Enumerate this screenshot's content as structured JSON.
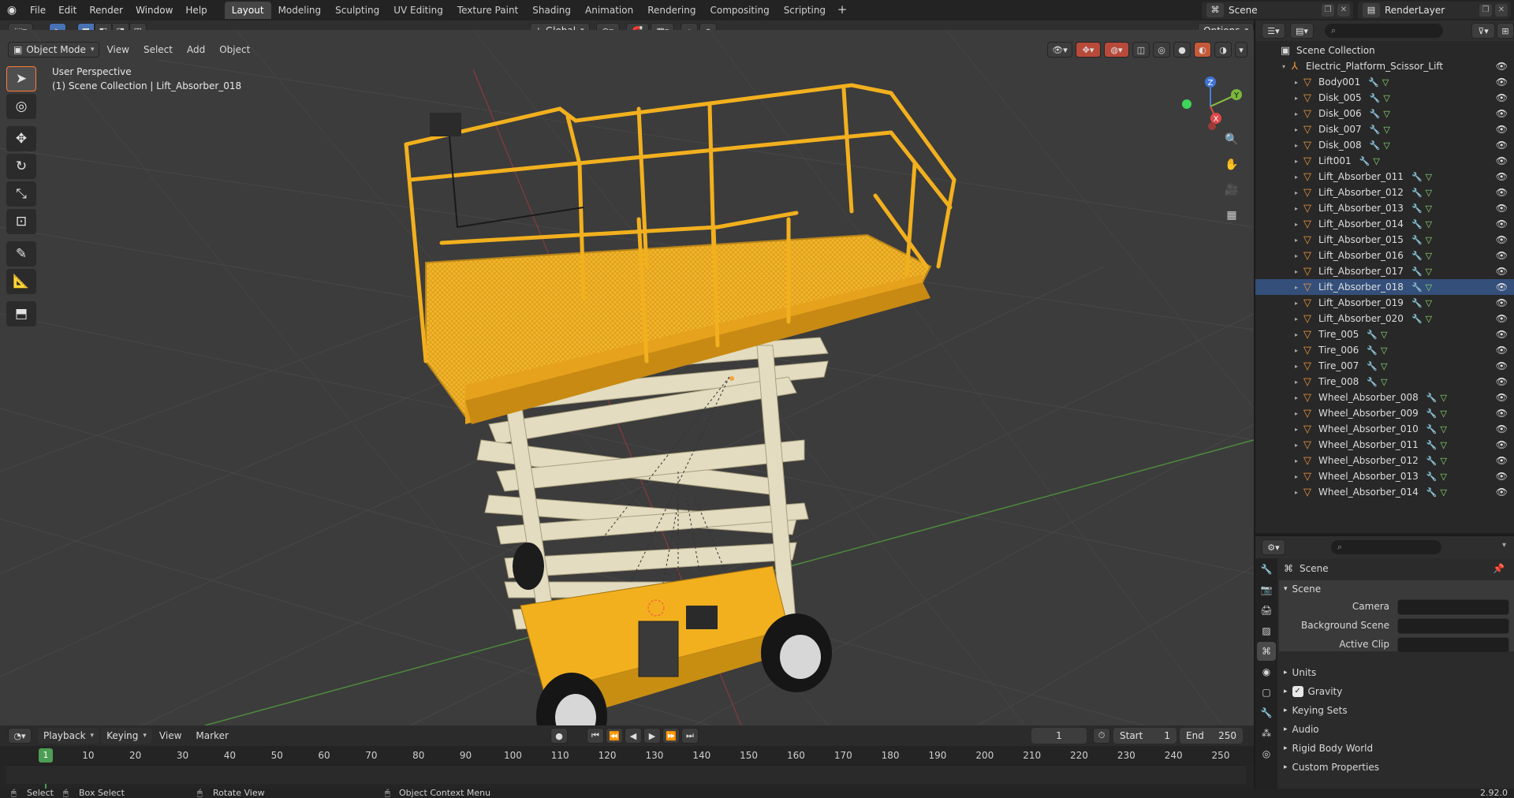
{
  "topbar": {
    "menus": [
      "File",
      "Edit",
      "Render",
      "Window",
      "Help"
    ],
    "workspaces": [
      "Layout",
      "Modeling",
      "Sculpting",
      "UV Editing",
      "Texture Paint",
      "Shading",
      "Animation",
      "Rendering",
      "Compositing",
      "Scripting"
    ],
    "active_workspace": "Layout",
    "scene_name": "Scene",
    "view_layer": "RenderLayer"
  },
  "viewport": {
    "mode": "Object Mode",
    "menus": [
      "View",
      "Select",
      "Add",
      "Object"
    ],
    "orientation": "Global",
    "options_label": "Options",
    "perspective_label": "User Perspective",
    "collection_label": "(1) Scene Collection | Lift_Absorber_018",
    "gizmo_axes": [
      "X",
      "Y",
      "Z"
    ]
  },
  "timeline": {
    "menus": [
      "Playback",
      "Keying",
      "View",
      "Marker"
    ],
    "current_frame": "1",
    "start_label": "Start",
    "start_value": "1",
    "end_label": "End",
    "end_value": "250",
    "ruler": [
      "1",
      "10",
      "20",
      "30",
      "40",
      "50",
      "60",
      "70",
      "80",
      "90",
      "100",
      "110",
      "120",
      "130",
      "140",
      "150",
      "160",
      "170",
      "180",
      "190",
      "200",
      "210",
      "220",
      "230",
      "240",
      "250"
    ]
  },
  "outliner": {
    "root": "Scene Collection",
    "parent": "Electric_Platform_Scissor_Lift",
    "selected": "Lift_Absorber_018",
    "items": [
      "Body001",
      "Disk_005",
      "Disk_006",
      "Disk_007",
      "Disk_008",
      "Lift001",
      "Lift_Absorber_011",
      "Lift_Absorber_012",
      "Lift_Absorber_013",
      "Lift_Absorber_014",
      "Lift_Absorber_015",
      "Lift_Absorber_016",
      "Lift_Absorber_017",
      "Lift_Absorber_018",
      "Lift_Absorber_019",
      "Lift_Absorber_020",
      "Tire_005",
      "Tire_006",
      "Tire_007",
      "Tire_008",
      "Wheel_Absorber_008",
      "Wheel_Absorber_009",
      "Wheel_Absorber_010",
      "Wheel_Absorber_011",
      "Wheel_Absorber_012",
      "Wheel_Absorber_013",
      "Wheel_Absorber_014"
    ]
  },
  "properties": {
    "context": "Scene",
    "panel_title": "Scene",
    "fields": [
      {
        "label": "Camera"
      },
      {
        "label": "Background Scene"
      },
      {
        "label": "Active Clip"
      }
    ],
    "sections": [
      "Units",
      "Gravity",
      "Keying Sets",
      "Audio",
      "Rigid Body World",
      "Custom Properties"
    ],
    "gravity_checked": true
  },
  "statusbar": {
    "select": "Select",
    "box_select": "Box Select",
    "rotate_view": "Rotate View",
    "context_menu": "Object Context Menu",
    "version": "2.92.0"
  },
  "colors": {
    "accent": "#4772b3",
    "active_tool_border": "#ff7a35",
    "mesh_icon": "#f0973c",
    "lift_yellow": "#f2b01e",
    "scissor_beige": "#e3dcc0",
    "playhead": "#4c9e54"
  }
}
